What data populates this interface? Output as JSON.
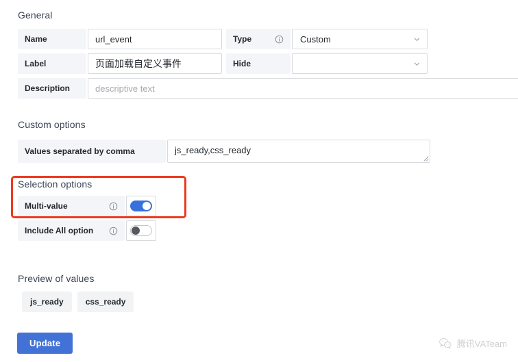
{
  "sections": {
    "general": "General",
    "custom_options": "Custom options",
    "selection_options": "Selection options",
    "preview_of_values": "Preview of values"
  },
  "general": {
    "name": {
      "label": "Name",
      "value": "url_event"
    },
    "type": {
      "label": "Type",
      "info_icon": "info-circle-icon",
      "value": "Custom",
      "chevron_icon": "chevron-down-icon"
    },
    "label_field": {
      "label": "Label",
      "value": "页面加载自定义事件"
    },
    "hide": {
      "label": "Hide",
      "value": "",
      "chevron_icon": "chevron-down-icon"
    },
    "description": {
      "label": "Description",
      "value": "",
      "placeholder": "descriptive text"
    }
  },
  "custom_options": {
    "values": {
      "label": "Values separated by comma",
      "value": "js_ready,css_ready",
      "resize_icon": "resize-grip-icon"
    }
  },
  "selection_options": {
    "multi_value": {
      "label": "Multi-value",
      "info_icon": "info-circle-icon",
      "state": "on"
    },
    "include_all": {
      "label": "Include All option",
      "info_icon": "info-circle-icon",
      "state": "off"
    }
  },
  "preview": {
    "chips": [
      "js_ready",
      "css_ready"
    ]
  },
  "actions": {
    "update_label": "Update"
  },
  "watermark": {
    "text": "腾讯VATeam",
    "icon": "wechat-logo-icon"
  },
  "colors": {
    "accent_blue": "#4372d6",
    "toggle_on": "#3871dc",
    "annotation_red": "#ed3a1e",
    "label_bg": "#f4f5f8",
    "border": "#d8dade"
  }
}
